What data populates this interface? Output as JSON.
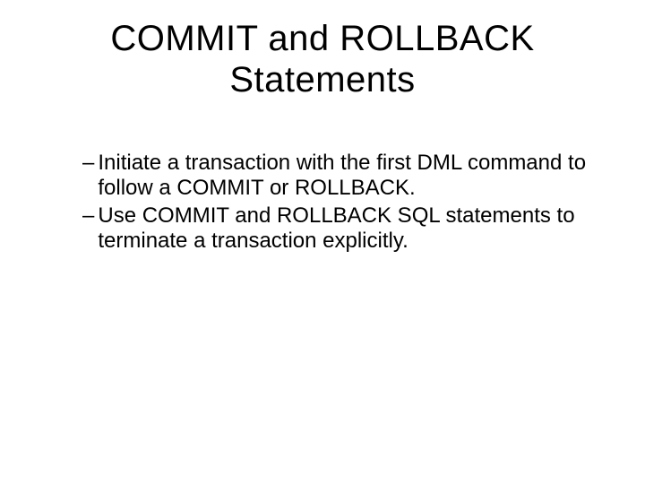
{
  "title": "COMMIT and ROLLBACK Statements",
  "bullets": [
    {
      "dash": "–",
      "text": "Initiate a transaction with the first DML command to follow a COMMIT or ROLLBACK."
    },
    {
      "dash": "–",
      "text": "Use COMMIT and ROLLBACK SQL statements to terminate a transaction explicitly."
    }
  ]
}
